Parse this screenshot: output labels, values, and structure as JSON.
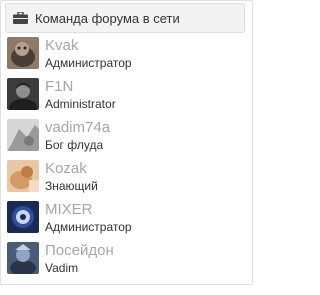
{
  "widget": {
    "title": "Команда форума в сети",
    "icon": "briefcase-icon"
  },
  "members": [
    {
      "name": "Kvak",
      "role": "Администратор"
    },
    {
      "name": "F1N",
      "role": "Administrator"
    },
    {
      "name": "vadim74a",
      "role": "Бог флуда"
    },
    {
      "name": "Kozak",
      "role": "Знающий"
    },
    {
      "name": "MIXER",
      "role": "Администратор"
    },
    {
      "name": "Посейдон",
      "role": "Vadim"
    }
  ]
}
